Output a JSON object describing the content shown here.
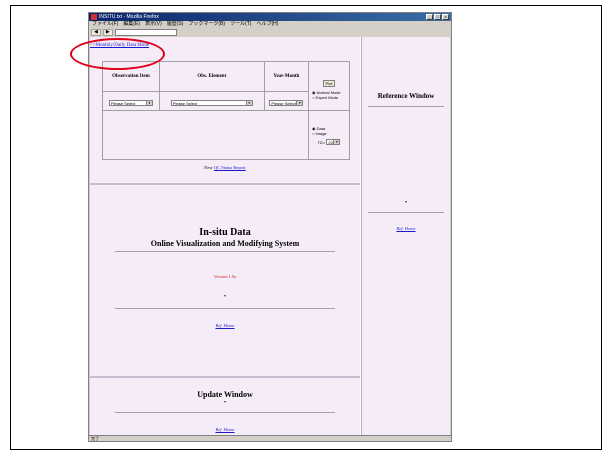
{
  "window": {
    "title": "INSITU.txt - Mozilla Firefox",
    "controls": [
      "_",
      "□",
      "x"
    ]
  },
  "menu": [
    "ファイル(F)",
    "編集(E)",
    "表示(V)",
    "履歴(S)",
    "ブックマーク(B)",
    "ツール(T)",
    "ヘルプ(H)"
  ],
  "toolbar": {
    "back_label": "◀",
    "forward_label": "▶"
  },
  "breadcrumb": "<<Monthly/Daily Data Mode",
  "selector": {
    "headers": [
      "Observation Item",
      "Obs. Element",
      "Year-Month"
    ],
    "dropdown_value": "Please Select",
    "plot_button": "Plot",
    "modes": [
      "Normal Mode",
      "Expert Mode"
    ],
    "types": [
      "Data",
      "Image"
    ],
    "td_label": "TD=",
    "td_value": "20"
  },
  "qc_link_prefix": "New ",
  "qc_link": "QC Status Report",
  "main": {
    "title_line1": "In-situ Data",
    "title_line2": "Online Visualization and Modifying System",
    "version": "Version 1.0a",
    "dot": "•",
    "link": "Ref. Home"
  },
  "update": {
    "title": "Update Window",
    "dot": "•",
    "link": "Ref. Home"
  },
  "reference": {
    "title": "Reference Window",
    "dot": "•",
    "link": "Ref. Home"
  },
  "status": "完了",
  "colors": {
    "panel_bg": "#f5ecf8",
    "highlight_oval": "#e0001a",
    "link": "#1a1acc",
    "version_text": "#d02020"
  }
}
